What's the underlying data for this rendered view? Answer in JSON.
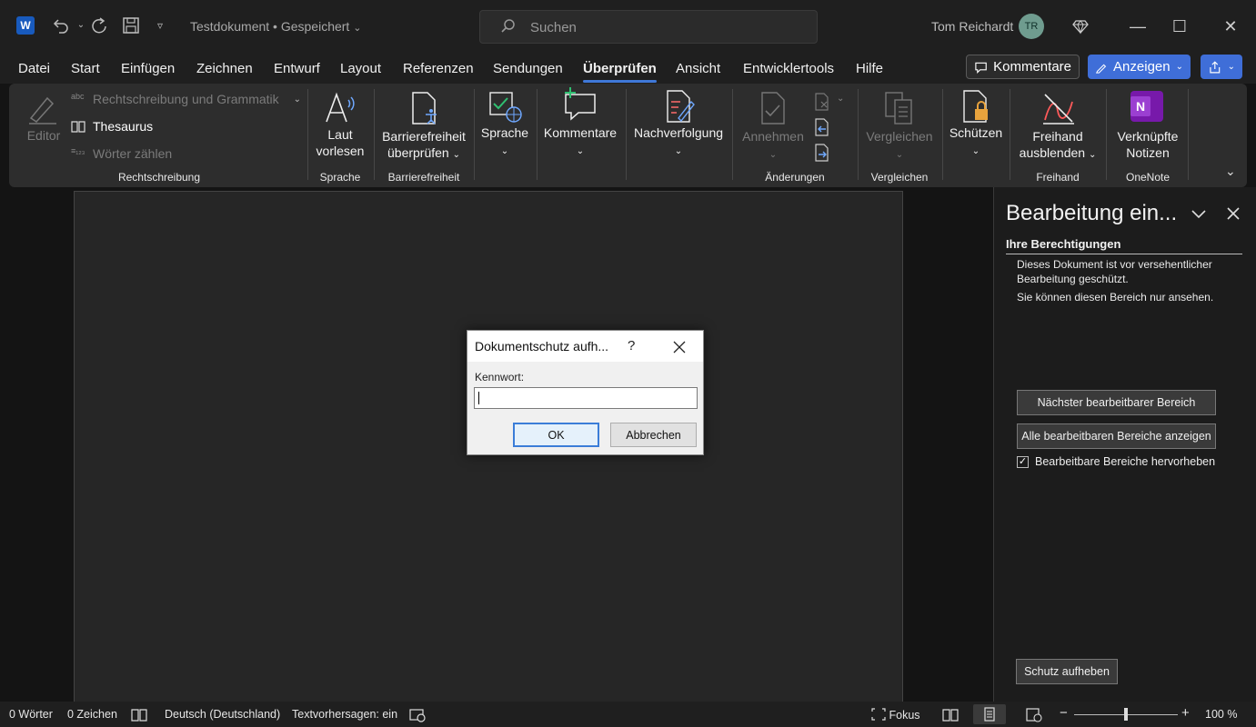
{
  "titlebar": {
    "app_letter": "W",
    "doc_title": "Testdokument • Gespeichert",
    "search_placeholder": "Suchen",
    "user_name": "Tom Reichardt",
    "user_initials": "TR",
    "icons": [
      "undo-icon",
      "redo-icon",
      "save-icon",
      "customize-icon",
      "diamond-icon",
      "minimize-icon",
      "maximize-icon",
      "close-icon"
    ]
  },
  "tabs": [
    "Datei",
    "Start",
    "Einfügen",
    "Zeichnen",
    "Entwurf",
    "Layout",
    "Referenzen",
    "Sendungen",
    "Überprüfen",
    "Ansicht",
    "Entwicklertools",
    "Hilfe"
  ],
  "active_tab": "Überprüfen",
  "top_buttons": {
    "kommentare": "Kommentare",
    "anzeigen": "Anzeigen"
  },
  "ribbon": {
    "editor": "Editor",
    "spelling": "Rechtschreibung und Grammatik",
    "thesaurus": "Thesaurus",
    "word_count": "Wörter zählen",
    "group_rechtschreibung": "Rechtschreibung",
    "laut_line1": "Laut",
    "laut_line2": "vorlesen",
    "group_sprache": "Sprache",
    "barriere_line1": "Barrierefreiheit",
    "barriere_line2": "überprüfen",
    "group_barriere": "Barrierefreiheit",
    "sprache": "Sprache",
    "kommentare": "Kommentare",
    "nachverfolgung": "Nachverfolgung",
    "annehmen": "Annehmen",
    "group_aenderungen": "Änderungen",
    "vergleichen": "Vergleichen",
    "group_vergleichen": "Vergleichen",
    "schuetzen": "Schützen",
    "freihand_line1": "Freihand",
    "freihand_line2": "ausblenden",
    "group_freihand": "Freihand",
    "notizen_line1": "Verknüpfte",
    "notizen_line2": "Notizen",
    "group_onenote": "OneNote"
  },
  "pane": {
    "title": "Bearbeitung ein...",
    "subtitle": "Ihre Berechtigungen",
    "text1": "Dieses Dokument ist vor versehentlicher Bearbeitung geschützt.",
    "text2": "Sie können diesen Bereich nur ansehen.",
    "btn_next": "Nächster bearbeitbarer Bereich",
    "btn_all": "Alle bearbeitbaren Bereiche anzeigen",
    "check_label": "Bearbeitbare Bereiche hervorheben",
    "check_checked": true,
    "btn_unprotect": "Schutz aufheben"
  },
  "dialog": {
    "title": "Dokumentschutz aufh...",
    "help": "?",
    "label": "Kennwort:",
    "password_value": "",
    "ok": "OK",
    "cancel": "Abbrechen"
  },
  "status": {
    "words": "0 Wörter",
    "chars": "0 Zeichen",
    "language": "Deutsch (Deutschland)",
    "predictions": "Textvorhersagen: ein",
    "focus": "Fokus",
    "zoom_minus": "−",
    "zoom_plus": "+",
    "zoom": "100 %"
  },
  "colors": {
    "accent": "#3f6ed8",
    "tab_underline": "#3f78d8",
    "ribbon_bg": "#2d2d2d",
    "page_bg": "#262626"
  }
}
